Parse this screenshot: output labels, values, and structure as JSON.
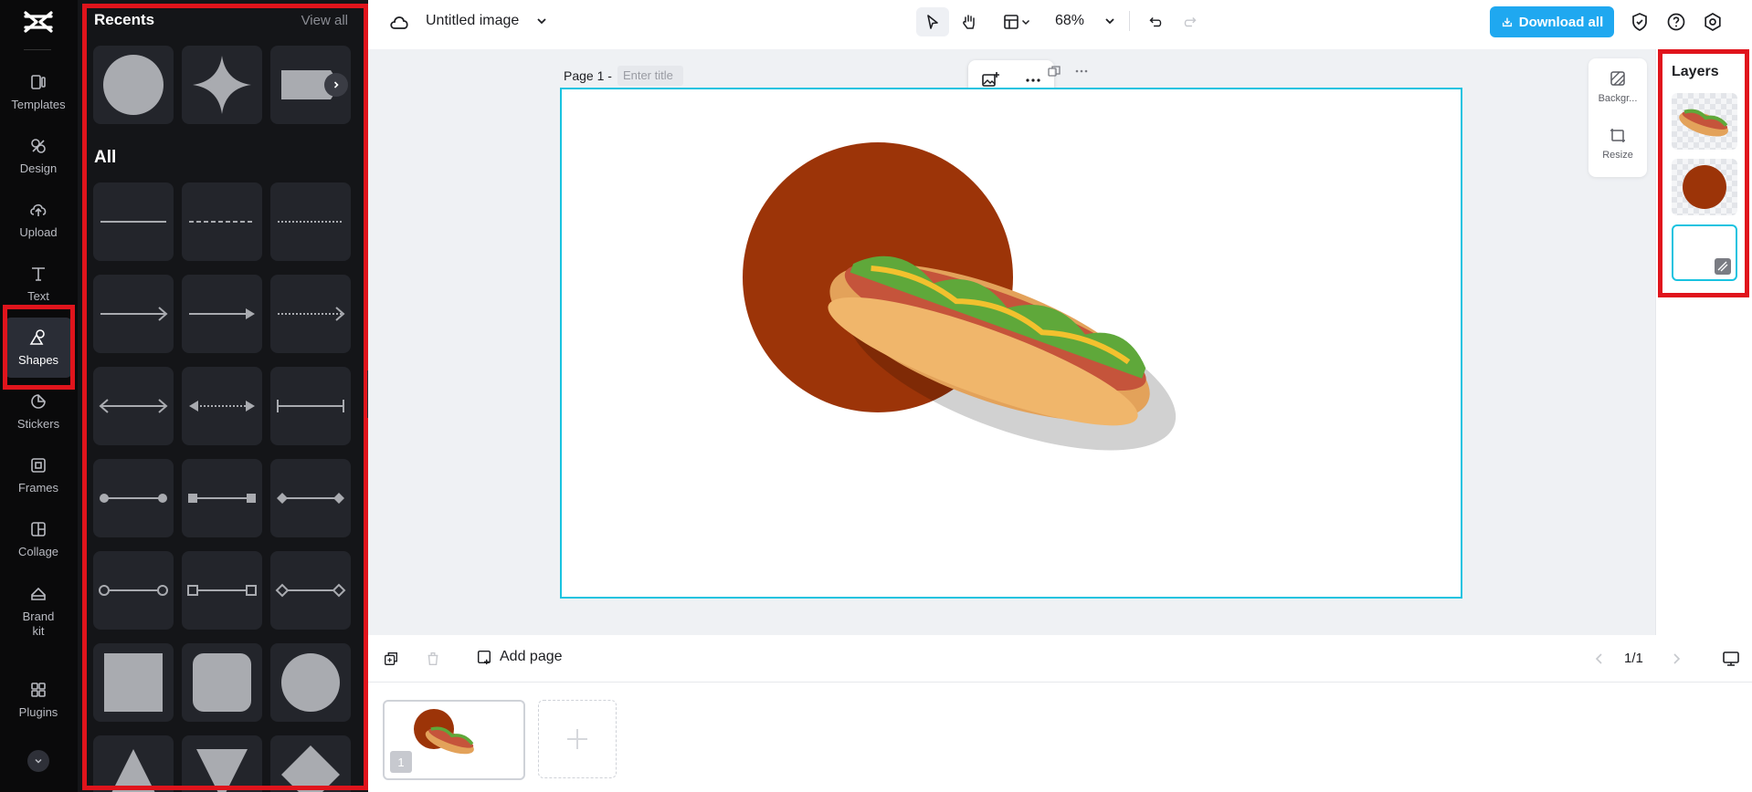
{
  "rail": {
    "items": [
      {
        "label": "Templates",
        "icon": "templates-icon"
      },
      {
        "label": "Design",
        "icon": "design-icon"
      },
      {
        "label": "Upload",
        "icon": "upload-icon"
      },
      {
        "label": "Text",
        "icon": "text-icon"
      },
      {
        "label": "Shapes",
        "icon": "shapes-icon",
        "active": true
      },
      {
        "label": "Stickers",
        "icon": "stickers-icon"
      },
      {
        "label": "Frames",
        "icon": "frames-icon"
      },
      {
        "label": "Collage",
        "icon": "collage-icon"
      },
      {
        "label": "Brand\nkit",
        "icon": "brand-kit-icon"
      },
      {
        "label": "Plugins",
        "icon": "plugins-icon"
      }
    ]
  },
  "panel": {
    "recents_title": "Recents",
    "view_all": "View all",
    "all_title": "All"
  },
  "topbar": {
    "doc_title": "Untitled image",
    "zoom": "68%",
    "download_label": "Download all"
  },
  "canvas": {
    "page_label": "Page 1 -",
    "title_placeholder": "Enter title",
    "circle_color": "#9c3408",
    "frame_color": "#19c3e0"
  },
  "side_tools": {
    "background_label": "Backgr...",
    "resize_label": "Resize"
  },
  "layers": {
    "title": "Layers"
  },
  "pagebar": {
    "add_page_label": "Add page",
    "page_count": "1/1",
    "thumb_number": "1"
  },
  "colors": {
    "accent": "#1fa8f0",
    "highlight": "#e0141c",
    "rail_bg": "#0a0a0b",
    "panel_bg": "#141518"
  }
}
